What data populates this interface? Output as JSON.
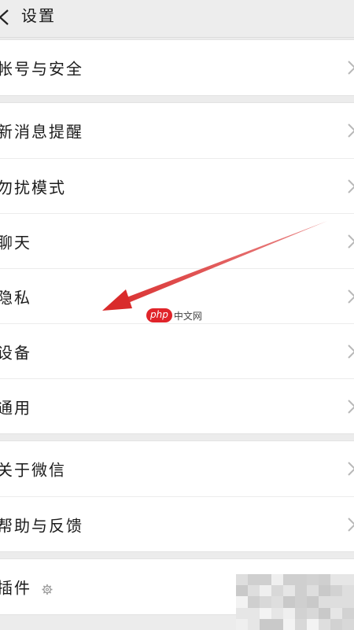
{
  "header": {
    "title": "设置",
    "back_icon": "chevron-left-icon"
  },
  "groups": [
    {
      "items": [
        {
          "label": "帐号与安全"
        }
      ]
    },
    {
      "items": [
        {
          "label": "新消息提醒"
        },
        {
          "label": "勿扰模式"
        },
        {
          "label": "聊天"
        },
        {
          "label": "隐私"
        },
        {
          "label": "设备"
        },
        {
          "label": "通用"
        }
      ]
    },
    {
      "items": [
        {
          "label": "关于微信"
        },
        {
          "label": "帮助与反馈"
        }
      ]
    },
    {
      "items": [
        {
          "label": "插件",
          "icon": "gear-icon"
        }
      ]
    }
  ],
  "annotation": {
    "arrow_color": "#d92b2b",
    "watermark_logo": "php",
    "watermark_text": "中文网"
  },
  "colors": {
    "background": "#ececec",
    "row_bg": "#ffffff",
    "chevron": "#b8b8b8",
    "watermark_red": "#e0242a"
  }
}
